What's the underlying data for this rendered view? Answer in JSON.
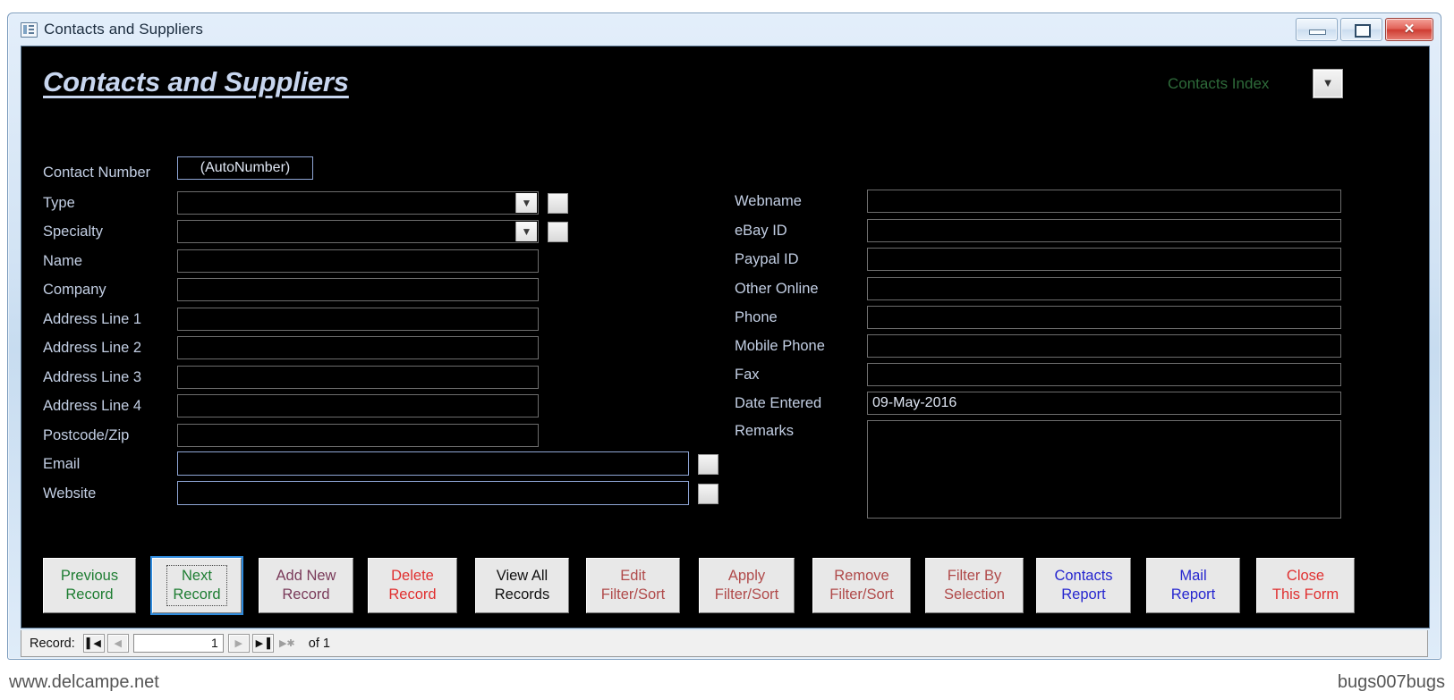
{
  "window": {
    "title": "Contacts and Suppliers",
    "icon": "form-icon",
    "minimize_label": "–",
    "maximize_label": "□",
    "close_label": "✕"
  },
  "form": {
    "title": "Contacts and Suppliers",
    "index_label": "Contacts Index",
    "index_dropdown_icon": "chevron-down-icon",
    "left_fields": [
      {
        "label": "Contact Number",
        "value": "(AutoNumber)",
        "type": "text-narrow",
        "highlight": true,
        "center": true
      },
      {
        "label": "Type",
        "value": "",
        "type": "combo",
        "highlight": false
      },
      {
        "label": "Specialty",
        "value": "",
        "type": "combo",
        "highlight": false
      },
      {
        "label": "Name",
        "value": "",
        "type": "text",
        "highlight": false
      },
      {
        "label": "Company",
        "value": "",
        "type": "text",
        "highlight": false
      },
      {
        "label": "Address Line 1",
        "value": "",
        "type": "text",
        "highlight": false
      },
      {
        "label": "Address Line 2",
        "value": "",
        "type": "text",
        "highlight": false
      },
      {
        "label": "Address Line 3",
        "value": "",
        "type": "text",
        "highlight": false
      },
      {
        "label": "Address Line 4",
        "value": "",
        "type": "text",
        "highlight": false
      },
      {
        "label": "Postcode/Zip",
        "value": "",
        "type": "text",
        "highlight": false
      },
      {
        "label": "Email",
        "value": "",
        "type": "wide-button",
        "highlight": true
      },
      {
        "label": "Website",
        "value": "",
        "type": "wide-button",
        "highlight": true
      }
    ],
    "right_fields": [
      {
        "label": "Webname",
        "value": ""
      },
      {
        "label": "eBay ID",
        "value": ""
      },
      {
        "label": "Paypal ID",
        "value": ""
      },
      {
        "label": "Other Online",
        "value": ""
      },
      {
        "label": "Phone",
        "value": ""
      },
      {
        "label": "Mobile Phone",
        "value": ""
      },
      {
        "label": "Fax",
        "value": ""
      },
      {
        "label": "Date Entered",
        "value": "09-May-2016"
      },
      {
        "label": "Remarks",
        "value": ""
      }
    ],
    "buttons": [
      {
        "line1": "Previous",
        "line2": "Record",
        "color": "#1e7d32",
        "focused": false
      },
      {
        "line1": "Next",
        "line2": "Record",
        "color": "#1e7d32",
        "focused": true
      },
      {
        "line1": "Add New",
        "line2": "Record",
        "color": "#7a3b5a",
        "focused": false
      },
      {
        "line1": "Delete",
        "line2": "Record",
        "color": "#e03030",
        "focused": false
      },
      {
        "line1": "View All",
        "line2": "Records",
        "color": "#111111",
        "focused": false
      },
      {
        "line1": "Edit",
        "line2": "Filter/Sort",
        "color": "#b04a4a",
        "focused": false
      },
      {
        "line1": "Apply",
        "line2": "Filter/Sort",
        "color": "#b04a4a",
        "focused": false
      },
      {
        "line1": "Remove",
        "line2": "Filter/Sort",
        "color": "#b04a4a",
        "focused": false
      },
      {
        "line1": "Filter By",
        "line2": "Selection",
        "color": "#b04a4a",
        "focused": false
      },
      {
        "line1": "Contacts",
        "line2": "Report",
        "color": "#2626cf",
        "topcolor": "#2626cf",
        "focused": false
      },
      {
        "line1": "Mail",
        "line2": "Report",
        "color": "#2626cf",
        "focused": false
      },
      {
        "line1": "Close",
        "line2": "This Form",
        "color": "#e03030",
        "focused": false
      }
    ]
  },
  "navigator": {
    "label": "Record:",
    "first_icon": "▌◀",
    "prev_icon": "◀",
    "value": "1",
    "next_icon": "▶",
    "last_icon": "▶▐",
    "new_icon": "▶✱",
    "of_text": "of  1"
  },
  "watermarks": {
    "left": "www.delcampe.net",
    "right": "bugs007bugs"
  }
}
